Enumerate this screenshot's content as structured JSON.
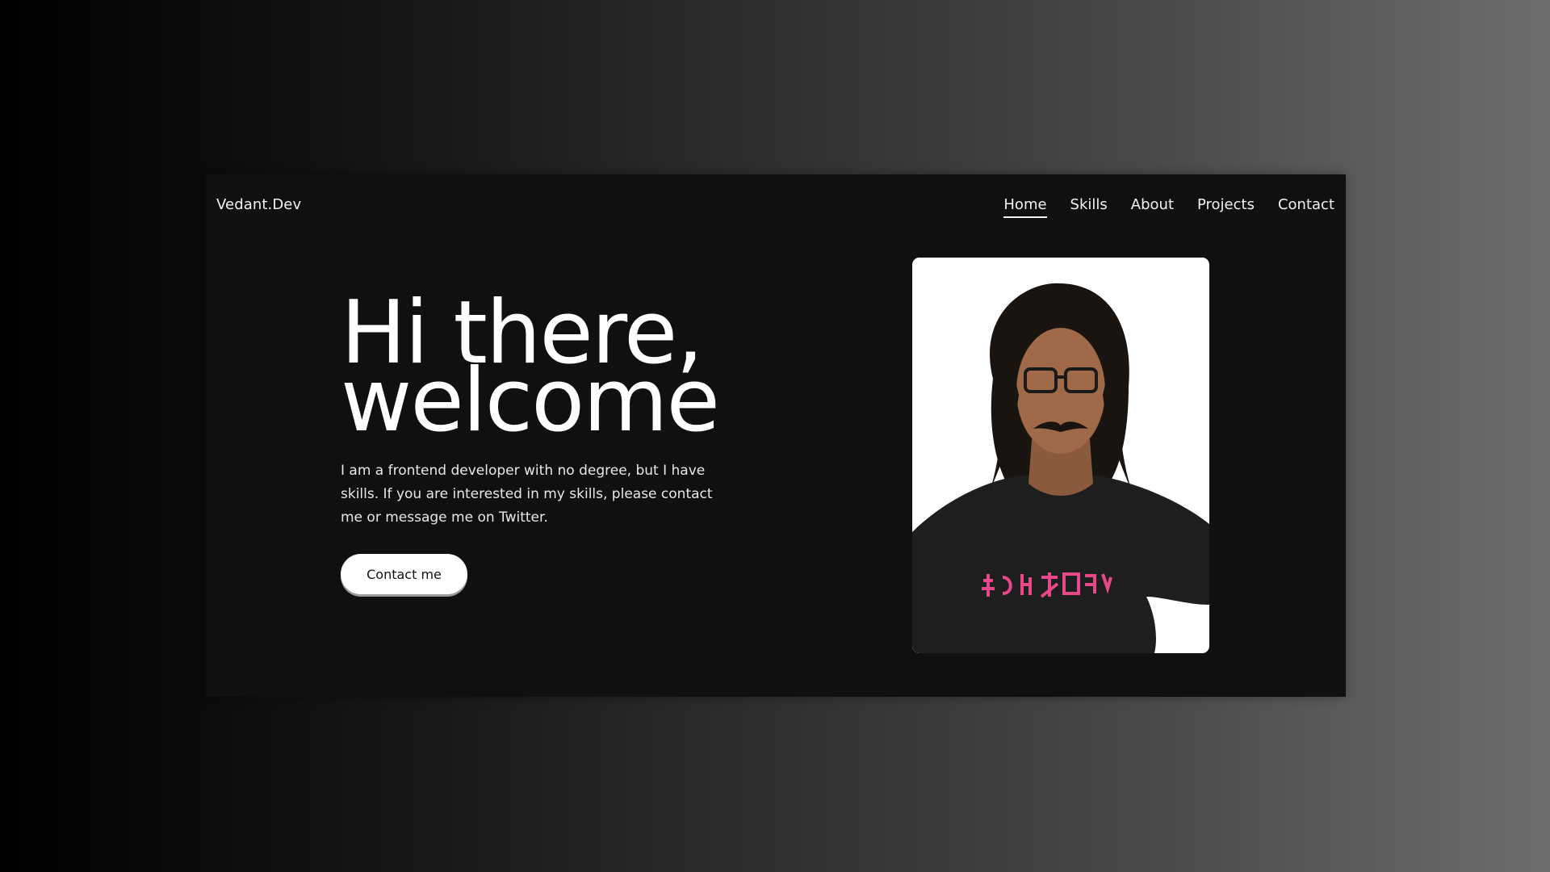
{
  "header": {
    "brand": "Vedant.Dev",
    "nav": [
      {
        "label": "Home",
        "active": true
      },
      {
        "label": "Skills",
        "active": false
      },
      {
        "label": "About",
        "active": false
      },
      {
        "label": "Projects",
        "active": false
      },
      {
        "label": "Contact",
        "active": false
      }
    ]
  },
  "hero": {
    "title_line1": "Hi there,",
    "title_line2": "welcome",
    "description": "I am a frontend developer with no degree, but I have skills. If you are interested in my skills, please contact me or message me on Twitter.",
    "cta_label": "Contact me"
  },
  "colors": {
    "frame_background": "#101010",
    "text": "#ffffff",
    "button_background": "#ffffff",
    "shirt_print": "#e8488a"
  }
}
